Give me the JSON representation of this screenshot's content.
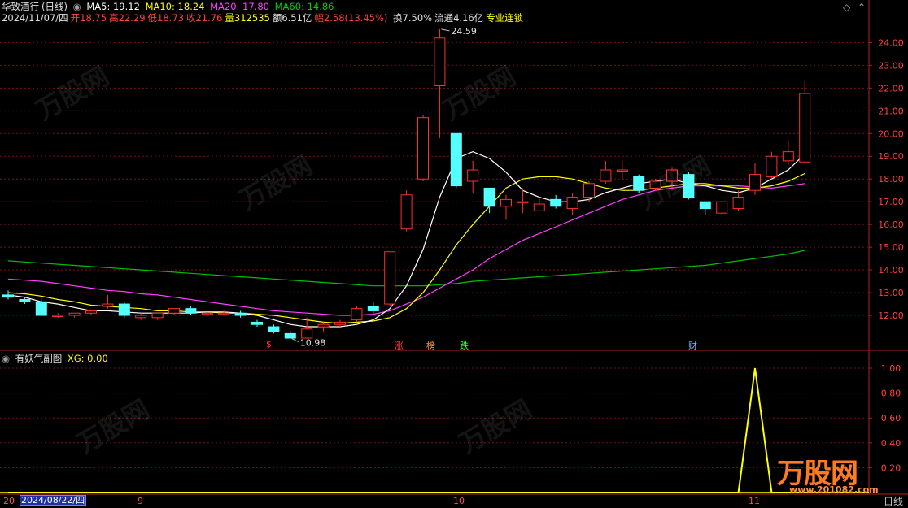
{
  "title_row": {
    "name": "华致酒行",
    "period": "(日线)",
    "ma5_label": "MA5: 19.12",
    "ma10_label": "MA10: 18.24",
    "ma20_label": "MA20: 17.80",
    "ma60_label": "MA60: 14.86"
  },
  "quote_row": {
    "date": "2024/11/07/四",
    "open": "开18.75",
    "high": "高22.29",
    "low": "低18.73",
    "close": "收21.76",
    "volume": "量312535",
    "amount": "额6.51亿",
    "change": "幅2.58(13.45%)",
    "turnover": "换7.50%",
    "float": "流通4.16亿",
    "tool": "专业连锁"
  },
  "price_axis": {
    "ticks": [
      "24.00",
      "23.00",
      "22.00",
      "21.00",
      "20.00",
      "19.00",
      "18.00",
      "17.00",
      "16.00",
      "15.00",
      "14.00",
      "13.00",
      "12.00"
    ]
  },
  "annotations": {
    "high_label": "24.59",
    "low_label": "10.98"
  },
  "event_tags": {
    "s": "$",
    "zhang": "涨",
    "bang": "榜",
    "die": "跌",
    "cai": "财"
  },
  "indicator": {
    "name": "有妖气副图",
    "xg_label": "XG: 0.00",
    "ticks": [
      "1.00",
      "0.80",
      "0.60",
      "0.40",
      "0.20"
    ]
  },
  "date_axis": {
    "start": "20",
    "selected": "2024/08/22/四",
    "m9": "9",
    "m10": "10",
    "m11": "11",
    "period_button": "日线"
  },
  "watermark": {
    "text": "万股网",
    "url": "www.201082.com"
  },
  "colors": {
    "up": "#ff3030",
    "down": "#54ffff",
    "ma5": "#ffffff",
    "ma10": "#ffff00",
    "ma20": "#ff40ff",
    "ma60": "#00c000"
  },
  "chart_data": {
    "type": "candlestick",
    "ylim": [
      10.5,
      24.8
    ],
    "candles": [
      {
        "o": 12.9,
        "h": 13.1,
        "l": 12.7,
        "c": 12.8
      },
      {
        "o": 12.7,
        "h": 12.8,
        "l": 12.5,
        "c": 12.6
      },
      {
        "o": 12.6,
        "h": 12.7,
        "l": 12.3,
        "c": 12.0
      },
      {
        "o": 12.0,
        "h": 12.1,
        "l": 11.9,
        "c": 12.0
      },
      {
        "o": 12.0,
        "h": 12.1,
        "l": 11.9,
        "c": 12.1
      },
      {
        "o": 12.1,
        "h": 12.2,
        "l": 12.0,
        "c": 12.2
      },
      {
        "o": 12.4,
        "h": 12.9,
        "l": 12.3,
        "c": 12.5
      },
      {
        "o": 12.5,
        "h": 12.6,
        "l": 11.9,
        "c": 12.0
      },
      {
        "o": 11.9,
        "h": 12.1,
        "l": 11.8,
        "c": 12.0
      },
      {
        "o": 11.9,
        "h": 12.1,
        "l": 11.8,
        "c": 12.1
      },
      {
        "o": 12.1,
        "h": 12.3,
        "l": 12.0,
        "c": 12.3
      },
      {
        "o": 12.3,
        "h": 12.4,
        "l": 12.0,
        "c": 12.1
      },
      {
        "o": 12.1,
        "h": 12.2,
        "l": 12.0,
        "c": 12.1
      },
      {
        "o": 12.1,
        "h": 12.2,
        "l": 12.0,
        "c": 12.1
      },
      {
        "o": 12.1,
        "h": 12.2,
        "l": 11.9,
        "c": 12.0
      },
      {
        "o": 11.7,
        "h": 11.8,
        "l": 11.5,
        "c": 11.6
      },
      {
        "o": 11.5,
        "h": 11.6,
        "l": 11.2,
        "c": 11.3
      },
      {
        "o": 11.2,
        "h": 11.3,
        "l": 10.98,
        "c": 11.0
      },
      {
        "o": 11.0,
        "h": 11.9,
        "l": 10.98,
        "c": 11.4
      },
      {
        "o": 11.5,
        "h": 11.7,
        "l": 11.3,
        "c": 11.6
      },
      {
        "o": 11.6,
        "h": 11.8,
        "l": 11.5,
        "c": 11.7
      },
      {
        "o": 11.8,
        "h": 12.4,
        "l": 11.7,
        "c": 12.3
      },
      {
        "o": 12.4,
        "h": 12.6,
        "l": 12.1,
        "c": 12.2
      },
      {
        "o": 12.5,
        "h": 14.8,
        "l": 12.4,
        "c": 14.8
      },
      {
        "o": 15.8,
        "h": 17.5,
        "l": 15.7,
        "c": 17.3
      },
      {
        "o": 18.0,
        "h": 20.8,
        "l": 17.9,
        "c": 20.7
      },
      {
        "o": 22.1,
        "h": 24.59,
        "l": 19.8,
        "c": 24.2
      },
      {
        "o": 20.0,
        "h": 20.0,
        "l": 17.6,
        "c": 17.7
      },
      {
        "o": 17.9,
        "h": 18.8,
        "l": 17.4,
        "c": 18.4
      },
      {
        "o": 17.6,
        "h": 17.6,
        "l": 16.5,
        "c": 16.8
      },
      {
        "o": 16.8,
        "h": 17.3,
        "l": 16.2,
        "c": 17.1
      },
      {
        "o": 17.0,
        "h": 17.6,
        "l": 16.5,
        "c": 17.0
      },
      {
        "o": 16.6,
        "h": 17.2,
        "l": 16.6,
        "c": 16.9
      },
      {
        "o": 17.1,
        "h": 17.3,
        "l": 16.7,
        "c": 16.8
      },
      {
        "o": 16.7,
        "h": 17.4,
        "l": 16.4,
        "c": 17.2
      },
      {
        "o": 17.2,
        "h": 17.9,
        "l": 17.0,
        "c": 17.8
      },
      {
        "o": 17.9,
        "h": 18.8,
        "l": 17.8,
        "c": 18.4
      },
      {
        "o": 18.4,
        "h": 18.8,
        "l": 18.0,
        "c": 18.4
      },
      {
        "o": 18.1,
        "h": 18.2,
        "l": 17.4,
        "c": 17.5
      },
      {
        "o": 17.6,
        "h": 18.0,
        "l": 17.5,
        "c": 17.9
      },
      {
        "o": 17.9,
        "h": 18.5,
        "l": 17.5,
        "c": 18.4
      },
      {
        "o": 18.2,
        "h": 18.3,
        "l": 17.1,
        "c": 17.2
      },
      {
        "o": 17.0,
        "h": 17.0,
        "l": 16.4,
        "c": 16.7
      },
      {
        "o": 16.5,
        "h": 17.0,
        "l": 16.4,
        "c": 17.0
      },
      {
        "o": 16.7,
        "h": 17.5,
        "l": 16.6,
        "c": 17.2
      },
      {
        "o": 17.5,
        "h": 18.7,
        "l": 17.3,
        "c": 18.2
      },
      {
        "o": 18.1,
        "h": 19.2,
        "l": 18.0,
        "c": 19.0
      },
      {
        "o": 18.8,
        "h": 19.7,
        "l": 18.6,
        "c": 19.2
      },
      {
        "o": 18.75,
        "h": 22.29,
        "l": 18.73,
        "c": 21.76
      }
    ],
    "ma": {
      "ma5": [
        12.9,
        12.8,
        12.6,
        12.5,
        12.35,
        12.2,
        12.2,
        12.15,
        12.1,
        12.1,
        12.1,
        12.1,
        12.15,
        12.15,
        12.1,
        12.0,
        11.8,
        11.6,
        11.5,
        11.5,
        11.5,
        11.6,
        11.8,
        12.3,
        13.3,
        14.9,
        17.2,
        18.9,
        19.2,
        18.9,
        18.3,
        17.5,
        17.2,
        17.0,
        17.0,
        17.1,
        17.4,
        17.6,
        17.8,
        17.9,
        18.0,
        17.8,
        17.7,
        17.5,
        17.4,
        17.6,
        18.0,
        18.4,
        19.1
      ],
      "ma10": [
        13.0,
        12.95,
        12.85,
        12.7,
        12.6,
        12.45,
        12.4,
        12.35,
        12.3,
        12.2,
        12.2,
        12.15,
        12.15,
        12.1,
        12.1,
        12.05,
        12.0,
        11.9,
        11.8,
        11.7,
        11.65,
        11.7,
        11.75,
        11.9,
        12.3,
        13.0,
        14.0,
        15.1,
        16.0,
        16.8,
        17.6,
        18.0,
        18.1,
        18.1,
        18.0,
        17.8,
        17.6,
        17.5,
        17.5,
        17.6,
        17.7,
        17.8,
        17.8,
        17.7,
        17.6,
        17.6,
        17.7,
        17.9,
        18.24
      ],
      "ma20": [
        13.6,
        13.55,
        13.5,
        13.4,
        13.3,
        13.2,
        13.1,
        13.05,
        12.95,
        12.9,
        12.8,
        12.7,
        12.6,
        12.5,
        12.4,
        12.3,
        12.2,
        12.15,
        12.1,
        12.05,
        12.0,
        12.0,
        12.05,
        12.2,
        12.5,
        12.8,
        13.2,
        13.6,
        14.0,
        14.5,
        14.9,
        15.3,
        15.6,
        15.9,
        16.2,
        16.5,
        16.8,
        17.1,
        17.3,
        17.5,
        17.6,
        17.7,
        17.7,
        17.7,
        17.7,
        17.65,
        17.6,
        17.7,
        17.8
      ],
      "ma60": [
        14.4,
        14.35,
        14.3,
        14.25,
        14.2,
        14.15,
        14.1,
        14.05,
        14.0,
        13.95,
        13.9,
        13.85,
        13.8,
        13.75,
        13.7,
        13.65,
        13.6,
        13.55,
        13.5,
        13.45,
        13.4,
        13.35,
        13.3,
        13.3,
        13.3,
        13.3,
        13.35,
        13.4,
        13.5,
        13.55,
        13.6,
        13.65,
        13.7,
        13.75,
        13.8,
        13.85,
        13.9,
        13.95,
        14.0,
        14.05,
        14.1,
        14.15,
        14.2,
        14.3,
        14.4,
        14.5,
        14.6,
        14.7,
        14.86
      ]
    },
    "indicator": {
      "ylim": [
        0,
        1.0
      ],
      "xg": [
        0,
        0,
        0,
        0,
        0,
        0,
        0,
        0,
        0,
        0,
        0,
        0,
        0,
        0,
        0,
        0,
        0,
        0,
        0,
        0,
        0,
        0,
        0,
        0,
        0,
        0,
        0,
        0,
        0,
        0,
        0,
        0,
        0,
        0,
        0,
        0,
        0,
        0,
        0,
        0,
        0,
        0,
        0,
        0,
        0,
        1,
        0,
        0,
        0
      ]
    }
  }
}
